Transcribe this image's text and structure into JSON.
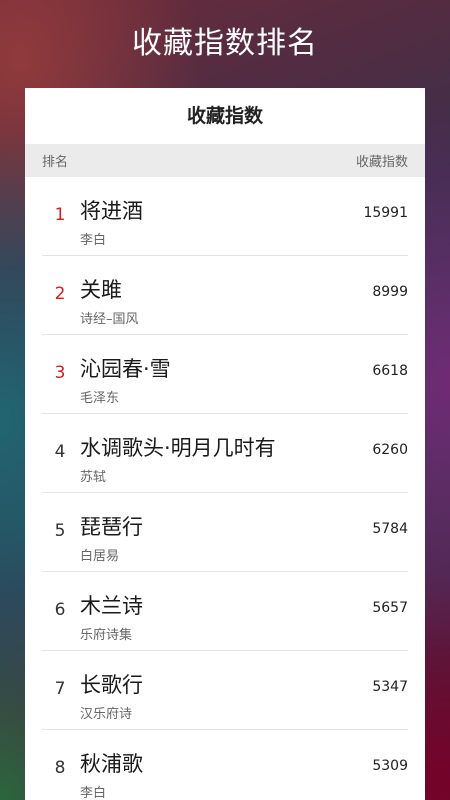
{
  "page": {
    "title": "收藏指数排名"
  },
  "card": {
    "title": "收藏指数",
    "header": {
      "rank_label": "排名",
      "score_label": "收藏指数"
    }
  },
  "ranking": [
    {
      "rank": "1",
      "title": "将进酒",
      "author": "李白",
      "score": "15991"
    },
    {
      "rank": "2",
      "title": "关雎",
      "author": "诗经–国风",
      "score": "8999"
    },
    {
      "rank": "3",
      "title": "沁园春·雪",
      "author": "毛泽东",
      "score": "6618"
    },
    {
      "rank": "4",
      "title": "水调歌头·明月几时有",
      "author": "苏轼",
      "score": "6260"
    },
    {
      "rank": "5",
      "title": "琵琶行",
      "author": "白居易",
      "score": "5784"
    },
    {
      "rank": "6",
      "title": "木兰诗",
      "author": "乐府诗集",
      "score": "5657"
    },
    {
      "rank": "7",
      "title": "长歌行",
      "author": "汉乐府诗",
      "score": "5347"
    },
    {
      "rank": "8",
      "title": "秋浦歌",
      "author": "李白",
      "score": "5309"
    }
  ],
  "colors": {
    "top_rank": "#cc1f1f",
    "rank": "#333333"
  }
}
